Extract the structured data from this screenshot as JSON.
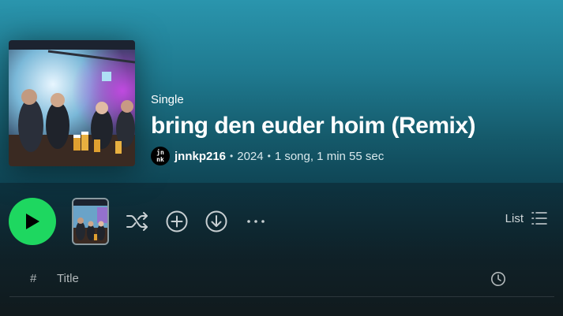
{
  "header": {
    "type_label": "Single",
    "title": "bring den euder hoim (Remix)",
    "artist": {
      "avatar_line1": "jn",
      "avatar_line2": "nk",
      "name": "jnnkp216"
    },
    "year": "2024",
    "summary": "1 song, 1 min 55 sec",
    "bullet": "•"
  },
  "actions": {
    "play_icon": "play-icon",
    "shuffle_icon": "shuffle-icon",
    "add_icon": "add-circle-icon",
    "download_icon": "download-icon",
    "more_icon": "more-icon",
    "view_label": "List",
    "view_icon": "list-icon"
  },
  "tracklist": {
    "header_number": "#",
    "header_title": "Title",
    "header_duration_icon": "clock-icon"
  },
  "colors": {
    "accent_green": "#1ed760",
    "hero_top": "#2a95ad",
    "hero_bottom": "#0f4656"
  }
}
